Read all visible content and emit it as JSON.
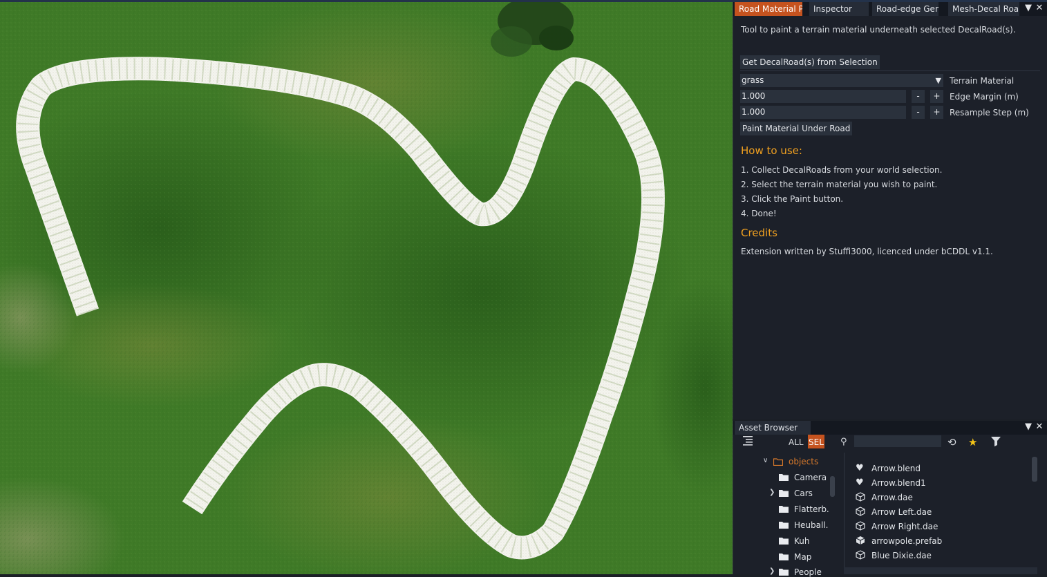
{
  "panel": {
    "tabs": [
      {
        "label": "Road Material P.",
        "active": true
      },
      {
        "label": "Inspector",
        "active": false
      },
      {
        "label": "Road-edge Gen.",
        "active": false
      },
      {
        "label": "Mesh-Decal Roa.",
        "active": false
      }
    ],
    "menu_icon": "dropdown-menu-icon",
    "close_icon": "close-icon",
    "description": "Tool to paint a terrain material underneath selected DecalRoad(s).",
    "get_button": "Get DecalRoad(s) from Selection",
    "material": {
      "value": "grass",
      "label": "Terrain Material"
    },
    "edge_margin": {
      "value": "1.000",
      "label": "Edge Margin (m)"
    },
    "resample_step": {
      "value": "1.000",
      "label": "Resample Step (m)"
    },
    "minus": "-",
    "plus": "+",
    "paint_button": "Paint Material Under Road",
    "how_title": "How to use:",
    "steps": [
      "1. Collect DecalRoads from your world selection.",
      "2. Select the terrain material you wish to paint.",
      "3. Click the Paint button.",
      "4. Done!"
    ],
    "credits_title": "Credits",
    "credits_text": "Extension written by Stuffi3000, licenced under bCDDL v1.1.",
    "accent_color": "#c5531f",
    "heading_color": "#f0a020"
  },
  "asset_browser": {
    "title": "Asset Browser",
    "filter_all": "ALL",
    "filter_sel": "SEL",
    "search_value": "",
    "tree": [
      {
        "label": "objects",
        "expanded": true,
        "highlight": true
      },
      {
        "label": "Camera",
        "expandable": false
      },
      {
        "label": "Cars",
        "expandable": true
      },
      {
        "label": "Flatterb.",
        "expandable": false
      },
      {
        "label": "Heuball.",
        "expandable": false
      },
      {
        "label": "Kuh",
        "expandable": false
      },
      {
        "label": "Map",
        "expandable": false
      },
      {
        "label": "People",
        "expandable": true
      }
    ],
    "files": [
      {
        "name": "Arrow.blend",
        "icon": "heart-icon"
      },
      {
        "name": "Arrow.blend1",
        "icon": "heart-icon"
      },
      {
        "name": "Arrow.dae",
        "icon": "cube-icon"
      },
      {
        "name": "Arrow Left.dae",
        "icon": "cube-icon"
      },
      {
        "name": "Arrow Right.dae",
        "icon": "cube-icon"
      },
      {
        "name": "arrowpole.prefab",
        "icon": "prefab-icon"
      },
      {
        "name": "Blue Dixie.dae",
        "icon": "cube-icon"
      }
    ]
  }
}
